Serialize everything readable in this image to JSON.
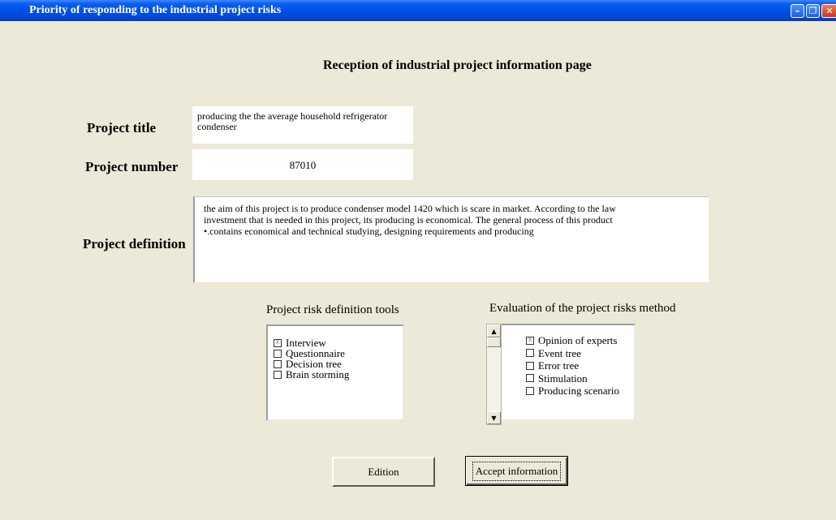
{
  "window": {
    "title": "Priority of responding to the industrial project risks",
    "min_glyph": "–",
    "max_glyph": "❐",
    "close_glyph": "✕"
  },
  "page": {
    "heading": "Reception of industrial project information page"
  },
  "form": {
    "project_title_label": "Project title",
    "project_title_value_line1": "producing the the average household refrigerator",
    "project_title_value_line2": "condenser",
    "project_number_label": "Project number",
    "project_number_value": "87010",
    "project_definition_label": "Project definition",
    "project_definition_line1": "the aim of this project is to produce condenser model 1420 which is scare in market. According to the law",
    "project_definition_line2": "investment that is needed in this project, its producing is economical. The general process of this product",
    "project_definition_line3": "•.contains economical and technical studying, designing requirements and producing"
  },
  "risk_tools": {
    "title": "Project risk definition tools",
    "items": [
      {
        "label": "Interview",
        "checked": true
      },
      {
        "label": "Questionnaire",
        "checked": false
      },
      {
        "label": "Decision tree",
        "checked": false
      },
      {
        "label": "Brain storming",
        "checked": false
      }
    ]
  },
  "evaluation_methods": {
    "title": "Evaluation of the project risks method",
    "items": [
      {
        "label": "Opinion of experts",
        "checked": true
      },
      {
        "label": "Event tree",
        "checked": false
      },
      {
        "label": "Error tree",
        "checked": false
      },
      {
        "label": "Stimulation",
        "checked": false
      },
      {
        "label": "Producing scenario",
        "checked": false
      }
    ]
  },
  "buttons": {
    "edition": "Edition",
    "accept": "Accept information"
  },
  "check_mark": "X"
}
